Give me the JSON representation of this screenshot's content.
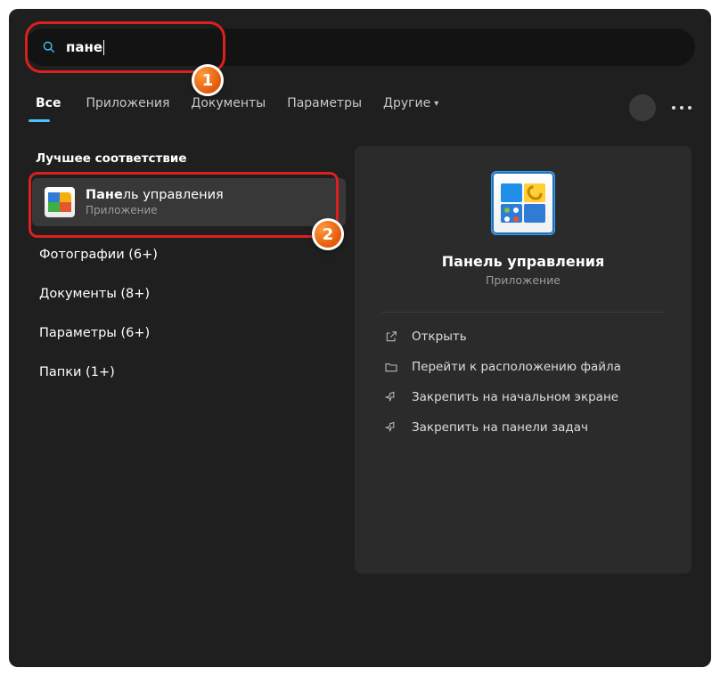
{
  "search": {
    "query_bold": "пане",
    "query_rest": ""
  },
  "tabs": {
    "all": "Все",
    "apps": "Приложения",
    "docs": "Документы",
    "params": "Параметры",
    "other": "Другие"
  },
  "left": {
    "best_label": "Лучшее соответствие",
    "best_title_bold": "Пане",
    "best_title_rest": "ль управления",
    "best_sub": "Приложение",
    "cats": [
      {
        "bold": "",
        "rest": "Фотографии (6+)"
      },
      {
        "bold": "",
        "rest": "Документы (8+)"
      },
      {
        "bold": "",
        "rest": "Параметры (6+)"
      },
      {
        "bold": "",
        "rest": "Папки (1+)"
      }
    ]
  },
  "right": {
    "title": "Панель управления",
    "sub": "Приложение",
    "actions": {
      "open": "Открыть",
      "location": "Перейти к расположению файла",
      "pin_start": "Закрепить на начальном экране",
      "pin_taskbar": "Закрепить на панели задач"
    }
  },
  "badges": {
    "one": "1",
    "two": "2"
  }
}
